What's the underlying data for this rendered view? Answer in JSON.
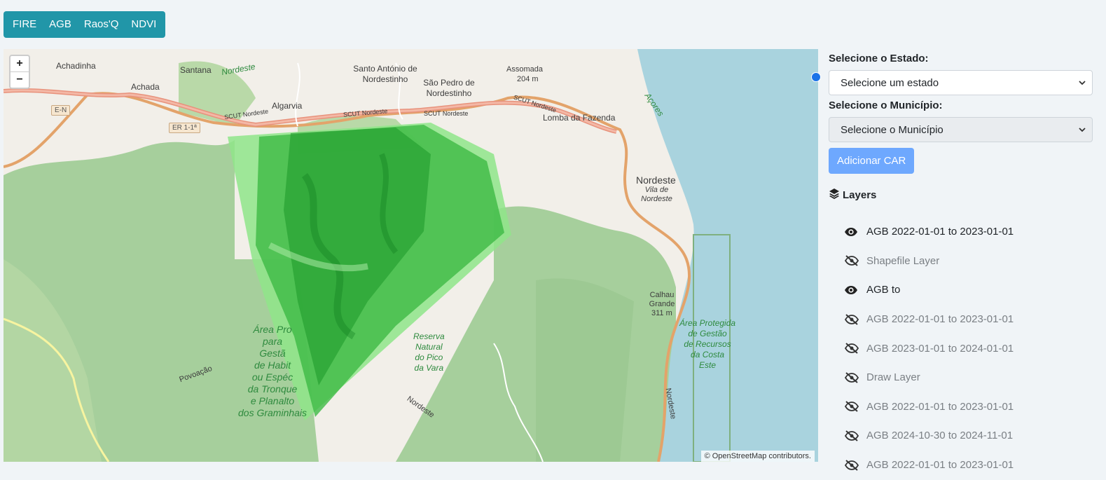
{
  "tabs": [
    "FIRE",
    "AGB",
    "Raos'Q",
    "NDVI"
  ],
  "map": {
    "zoom_in": "+",
    "zoom_out": "−",
    "attribution": "© OpenStreetMap contributors.",
    "place_labels": [
      "Achadinha",
      "Santana",
      "Nordeste",
      "Santo António de Nordestinho",
      "São Pedro de Nordestinho",
      "Assomada",
      "204 m",
      "Achada",
      "Algarvia",
      "Lomba da Fazenda",
      "Açores",
      "Nordeste",
      "Vila de Nordeste",
      "Calhau Grande",
      "311 m",
      "Povoação",
      "Nordeste",
      "Nordeste"
    ],
    "road_labels": [
      "SCUT Nordeste",
      "SCUT Nordeste",
      "SCUT Nordeste",
      "SCUT Nordeste"
    ],
    "shields": [
      "E-N",
      "ER 1-1ª"
    ],
    "area_labels": [
      "Área Pro\npara\nGestã\nde Habit\nou Espéc\nda Tronque\ne Planalto\ndos Graminhais",
      "Reserva\nNatural\ndo Pico\nda Vara",
      "Área Protegida\nde Gestão\nde Recursos\nda Costa\nEste"
    ],
    "colors": {
      "water": "#a9d3de",
      "land": "#f2efe9",
      "forest": "#a6cf9c",
      "overlay": "#2db43a",
      "road": "#f1a98c"
    }
  },
  "panel": {
    "state_label": "Selecione o Estado:",
    "state_value": "Selecione um estado",
    "municipio_label": "Selecione o Município:",
    "municipio_value": "Selecione o Município",
    "add_button": "Adicionar CAR",
    "layers_title": "Layers",
    "layers": [
      {
        "label": "AGB 2022-01-01 to 2023-01-01",
        "visible": true
      },
      {
        "label": "Shapefile Layer",
        "visible": false
      },
      {
        "label": "AGB to",
        "visible": true
      },
      {
        "label": "AGB 2022-01-01 to 2023-01-01",
        "visible": false
      },
      {
        "label": "AGB 2023-01-01 to 2024-01-01",
        "visible": false
      },
      {
        "label": "Draw Layer",
        "visible": false
      },
      {
        "label": "AGB 2022-01-01 to 2023-01-01",
        "visible": false
      },
      {
        "label": "AGB 2024-10-30 to 2024-11-01",
        "visible": false
      },
      {
        "label": "AGB 2022-01-01 to 2023-01-01",
        "visible": false
      }
    ]
  }
}
